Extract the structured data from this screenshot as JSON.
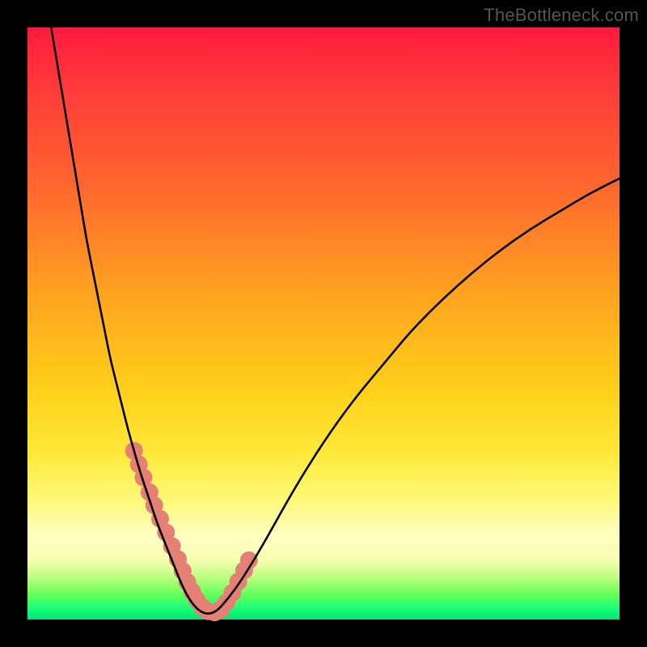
{
  "watermark": {
    "text": "TheBottleneck.com"
  },
  "chart_data": {
    "type": "line",
    "title": "",
    "xlabel": "",
    "ylabel": "",
    "xlim": [
      0,
      100
    ],
    "ylim": [
      0,
      100
    ],
    "grid": false,
    "legend": false,
    "series": [
      {
        "name": "curve",
        "x": [
          4,
          5,
          6,
          7,
          8,
          9,
          10,
          11,
          12,
          13,
          14,
          15,
          16,
          17,
          18,
          19,
          20,
          21,
          22,
          23,
          24,
          25,
          26,
          27,
          28,
          29,
          30,
          31,
          32,
          33,
          35,
          37,
          40,
          45,
          50,
          55,
          60,
          65,
          70,
          75,
          80,
          85,
          90,
          95,
          100
        ],
        "y": [
          100,
          94,
          88,
          82,
          76,
          70,
          64,
          59,
          54,
          49,
          44,
          40,
          36,
          32,
          28.5,
          25,
          22,
          19,
          16,
          13.5,
          11,
          8.5,
          6,
          4,
          2.5,
          1.5,
          1,
          1,
          1.5,
          2.5,
          5,
          8,
          13,
          22,
          30,
          37,
          43,
          49,
          54,
          58.5,
          62.5,
          66,
          69,
          72,
          74.5
        ]
      }
    ],
    "markers": [
      {
        "name": "dots",
        "x": [
          18,
          18.8,
          19.6,
          20.6,
          21.4,
          22.4,
          23.4,
          24.4,
          25.4,
          26.2,
          27,
          27.8,
          28.6,
          29.5,
          30.5,
          31.6,
          32.6,
          33.6,
          34.6,
          35.6,
          36.6,
          37.4
        ],
        "y": [
          28.5,
          26.2,
          24,
          21.5,
          19.3,
          17,
          14.7,
          12.4,
          10.2,
          8.2,
          6.3,
          4.7,
          3.3,
          2.1,
          1.4,
          1.2,
          1.7,
          2.9,
          4.5,
          6.4,
          8.3,
          10
        ],
        "color": "#e58074",
        "r": 11
      }
    ],
    "background_gradient": {
      "orientation": "vertical",
      "stops": [
        {
          "pos": 0.0,
          "color": "#ff1a3f"
        },
        {
          "pos": 0.28,
          "color": "#ff6a2d"
        },
        {
          "pos": 0.62,
          "color": "#ffd21a"
        },
        {
          "pos": 0.88,
          "color": "#f6ffb0"
        },
        {
          "pos": 1.0,
          "color": "#00e676"
        }
      ]
    }
  }
}
